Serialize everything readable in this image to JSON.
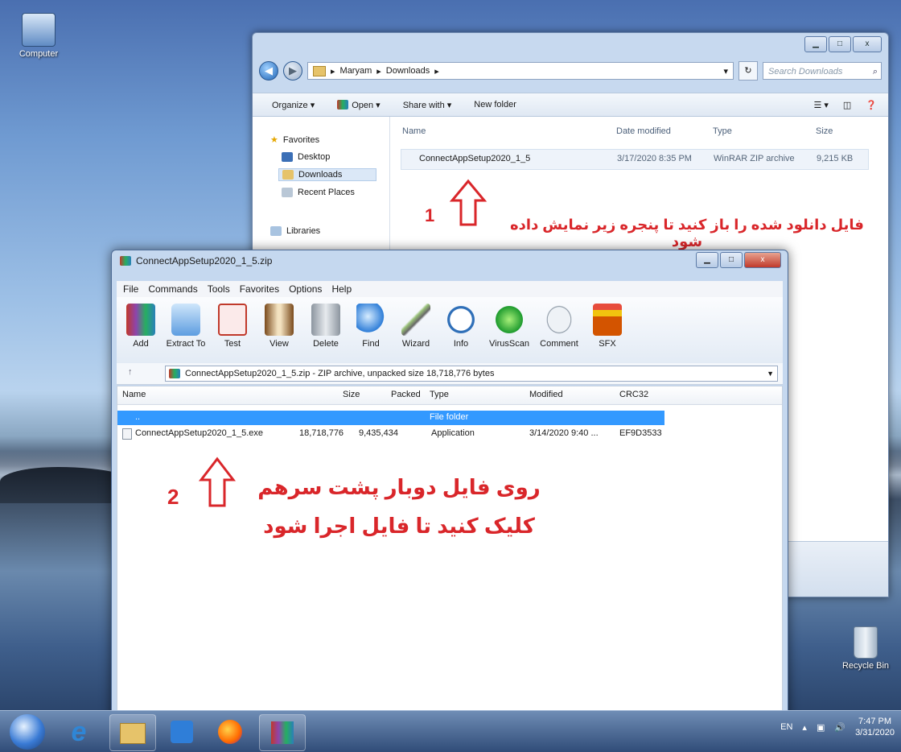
{
  "desktop": {
    "computer_label": "Computer",
    "recycle_label": "Recycle Bin"
  },
  "explorer": {
    "address": [
      "Maryam",
      "Downloads"
    ],
    "search_placeholder": "Search Downloads",
    "toolbar": {
      "organize": "Organize ▾",
      "open": "Open ▾",
      "share": "Share with ▾",
      "new_folder": "New folder"
    },
    "nav": {
      "favorites": "Favorites",
      "desktop": "Desktop",
      "downloads": "Downloads",
      "recent": "Recent Places",
      "libraries": "Libraries"
    },
    "columns": {
      "name": "Name",
      "date": "Date modified",
      "type": "Type",
      "size": "Size"
    },
    "file": {
      "name": "ConnectAppSetup2020_1_5",
      "date": "3/17/2020 8:35 PM",
      "type": "WinRAR ZIP archive",
      "size": "9,215 KB"
    }
  },
  "annotation1": {
    "number": "1",
    "text": "فایل دانلود شده را باز کنید تا پنجره زیر نمایش داده شود"
  },
  "annotation2": {
    "number": "2",
    "line1": "روی فایل دوبار پشت سرهم",
    "line2": "کلیک کنید تا فایل اجرا شود"
  },
  "winrar": {
    "title": "ConnectAppSetup2020_1_5.zip",
    "menu": [
      "File",
      "Commands",
      "Tools",
      "Favorites",
      "Options",
      "Help"
    ],
    "tools": [
      "Add",
      "Extract To",
      "Test",
      "View",
      "Delete",
      "Find",
      "Wizard",
      "Info",
      "VirusScan",
      "Comment",
      "SFX"
    ],
    "path": "ConnectAppSetup2020_1_5.zip - ZIP archive, unpacked size 18,718,776 bytes",
    "columns": {
      "name": "Name",
      "size": "Size",
      "packed": "Packed",
      "type": "Type",
      "modified": "Modified",
      "crc": "CRC32"
    },
    "rows": [
      {
        "name": "..",
        "size": "",
        "packed": "",
        "type": "File folder",
        "modified": "",
        "crc": ""
      },
      {
        "name": "ConnectAppSetup2020_1_5.exe",
        "size": "18,718,776",
        "packed": "9,435,434",
        "type": "Application",
        "modified": "3/14/2020 9:40 ...",
        "crc": "EF9D3533"
      }
    ]
  },
  "taskbar": {
    "lang": "EN",
    "time": "7:47 PM",
    "date": "3/31/2020"
  }
}
